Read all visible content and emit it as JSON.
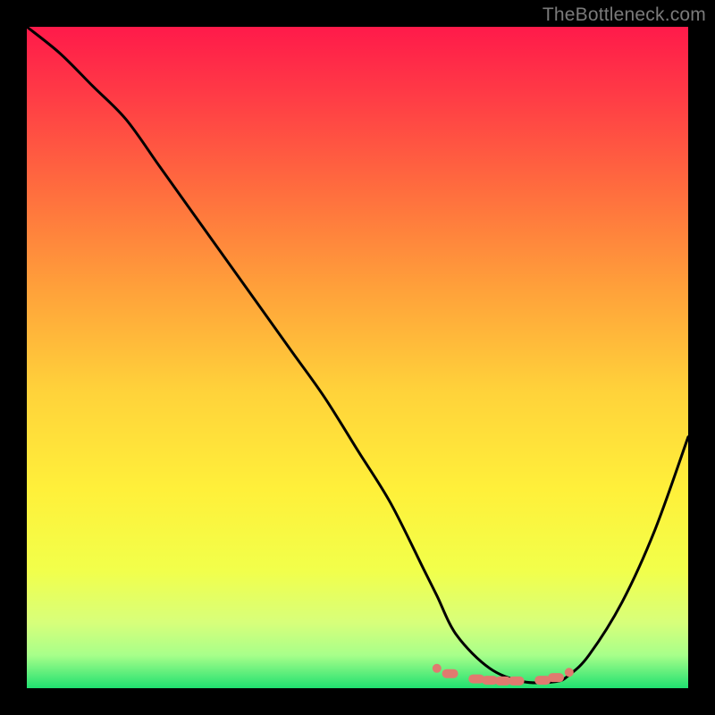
{
  "attribution": "TheBottleneck.com",
  "gradient": {
    "stops": [
      {
        "offset": 0.0,
        "color": "#ff1a4a"
      },
      {
        "offset": 0.1,
        "color": "#ff3a46"
      },
      {
        "offset": 0.25,
        "color": "#ff6e3e"
      },
      {
        "offset": 0.4,
        "color": "#ffa23a"
      },
      {
        "offset": 0.55,
        "color": "#ffd23a"
      },
      {
        "offset": 0.7,
        "color": "#fff03a"
      },
      {
        "offset": 0.82,
        "color": "#f2ff4a"
      },
      {
        "offset": 0.9,
        "color": "#d8ff7a"
      },
      {
        "offset": 0.95,
        "color": "#a8ff8a"
      },
      {
        "offset": 1.0,
        "color": "#20e070"
      }
    ]
  },
  "chart_data": {
    "type": "line",
    "title": "",
    "xlabel": "",
    "ylabel": "",
    "xlim": [
      0,
      100
    ],
    "ylim": [
      0,
      100
    ],
    "series": [
      {
        "name": "bottleneck-curve",
        "x": [
          0,
          5,
          10,
          15,
          20,
          25,
          30,
          35,
          40,
          45,
          50,
          55,
          60,
          62,
          65,
          70,
          75,
          80,
          82,
          85,
          90,
          95,
          100
        ],
        "values": [
          100,
          96,
          91,
          86,
          79,
          72,
          65,
          58,
          51,
          44,
          36,
          28,
          18,
          14,
          8,
          3,
          1,
          1,
          2,
          5,
          13,
          24,
          38
        ]
      }
    ],
    "markers": {
      "name": "highlight-band",
      "x": [
        62,
        64,
        68,
        70,
        72,
        74,
        78,
        80,
        82
      ],
      "values": [
        3,
        2.2,
        1.4,
        1.2,
        1.1,
        1.1,
        1.2,
        1.6,
        2.4
      ]
    }
  }
}
